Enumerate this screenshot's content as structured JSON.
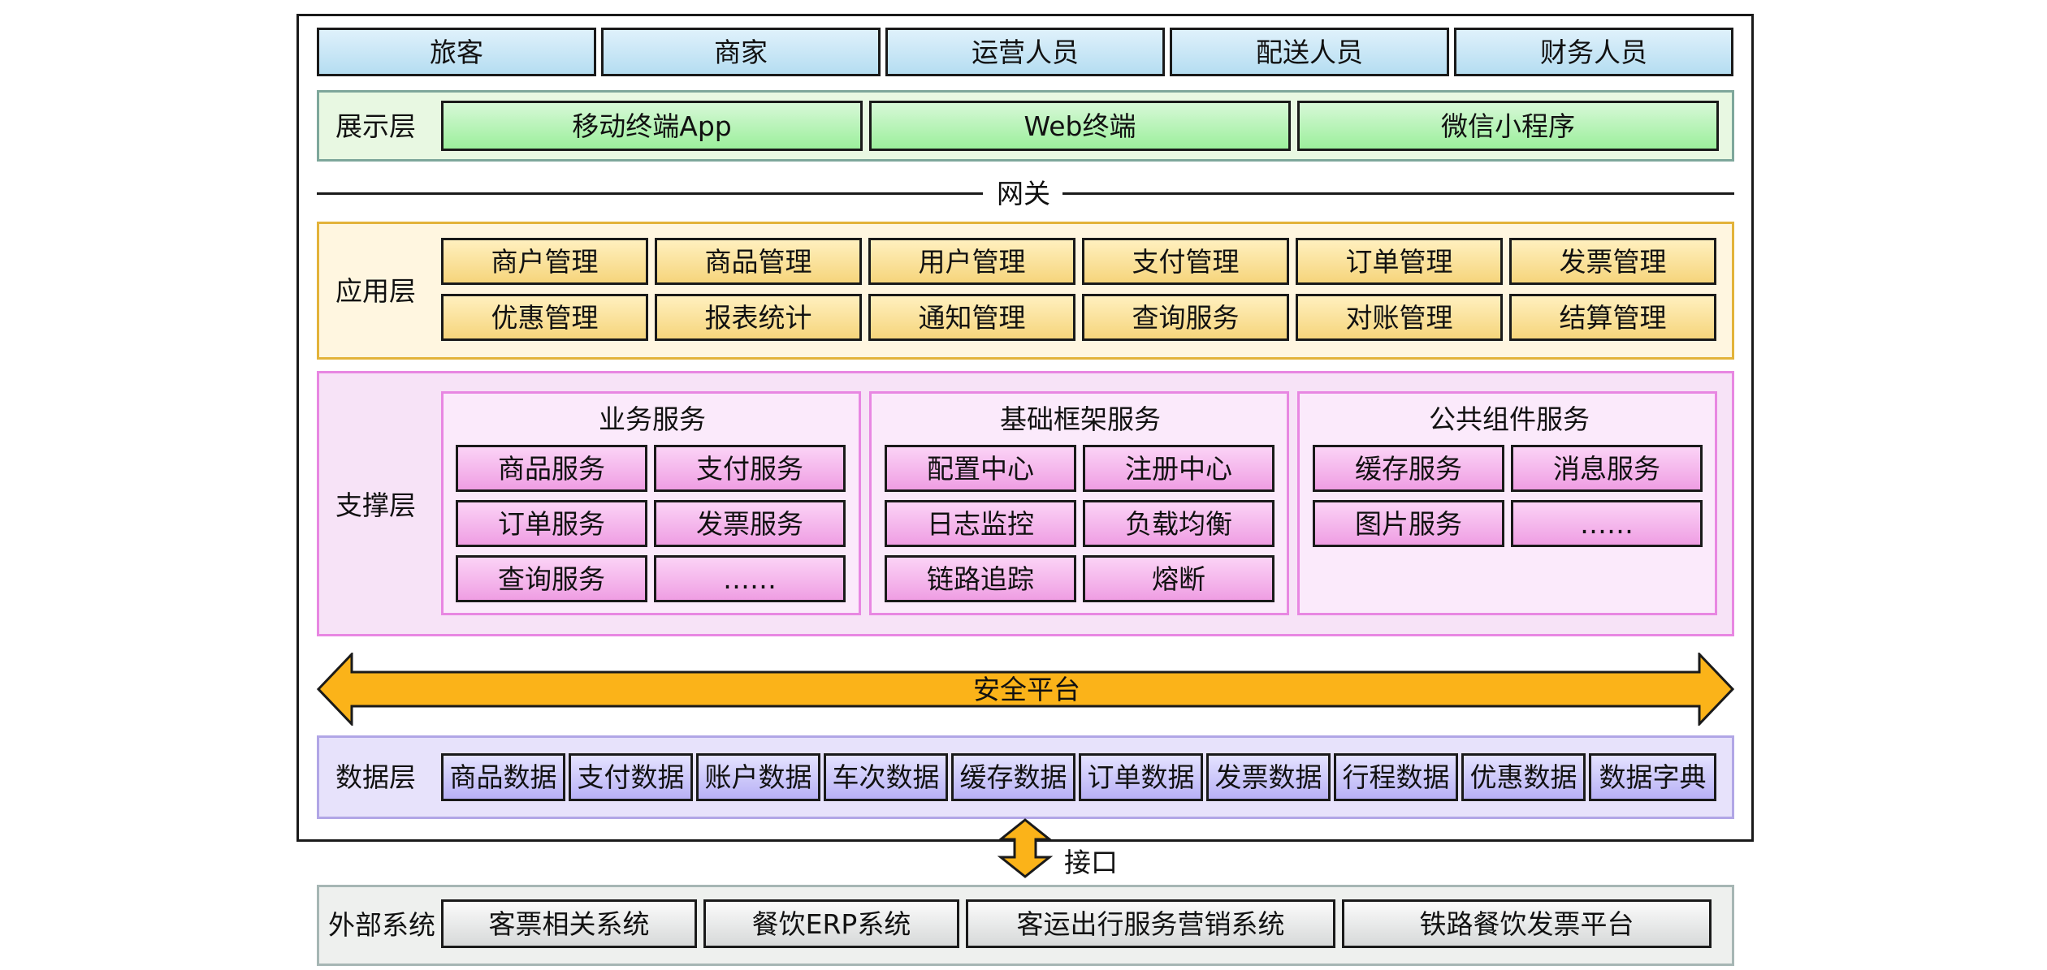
{
  "users": [
    "旅客",
    "商家",
    "运营人员",
    "配送人员",
    "财务人员"
  ],
  "presentation": {
    "label": "展示层",
    "items": [
      "移动终端App",
      "Web终端",
      "微信小程序"
    ]
  },
  "gateway": "网关",
  "application": {
    "label": "应用层",
    "row1": [
      "商户管理",
      "商品管理",
      "用户管理",
      "支付管理",
      "订单管理",
      "发票管理"
    ],
    "row2": [
      "优惠管理",
      "报表统计",
      "通知管理",
      "查询服务",
      "对账管理",
      "结算管理"
    ]
  },
  "support": {
    "label": "支撑层",
    "business": {
      "title": "业务服务",
      "items": [
        "商品服务",
        "支付服务",
        "订单服务",
        "发票服务",
        "查询服务",
        "……"
      ]
    },
    "framework": {
      "title": "基础框架服务",
      "items": [
        "配置中心",
        "注册中心",
        "日志监控",
        "负载均衡",
        "链路追踪",
        "熔断"
      ]
    },
    "common": {
      "title": "公共组件服务",
      "items": [
        "缓存服务",
        "消息服务",
        "图片服务",
        "……"
      ]
    }
  },
  "security": "安全平台",
  "data": {
    "label": "数据层",
    "items": [
      "商品数据",
      "支付数据",
      "账户数据",
      "车次数据",
      "缓存数据",
      "订单数据",
      "发票数据",
      "行程数据",
      "优惠数据",
      "数据字典"
    ]
  },
  "interface": "接口",
  "external": {
    "label": "外部系统",
    "items": [
      "客票相关系统",
      "餐饮ERP系统",
      "客运出行服务营销系统",
      "铁路餐饮发票平台"
    ]
  },
  "colors": {
    "user": "#b5ddf1",
    "presentation_bg": "#e8f8e2",
    "presentation_box": "#9cef9c",
    "application_bg": "#fff6e0",
    "application_box": "#f6d57c",
    "application_border": "#e3b33a",
    "support_bg": "#f7e3f7",
    "support_box": "#ef9ee3",
    "support_border": "#e887e2",
    "security_arrow": "#fbb319",
    "data_bg": "#e7e2fb",
    "data_box": "#b8b1f5",
    "external_bg": "#eef0ee",
    "external_box": "#d7d9d9"
  }
}
